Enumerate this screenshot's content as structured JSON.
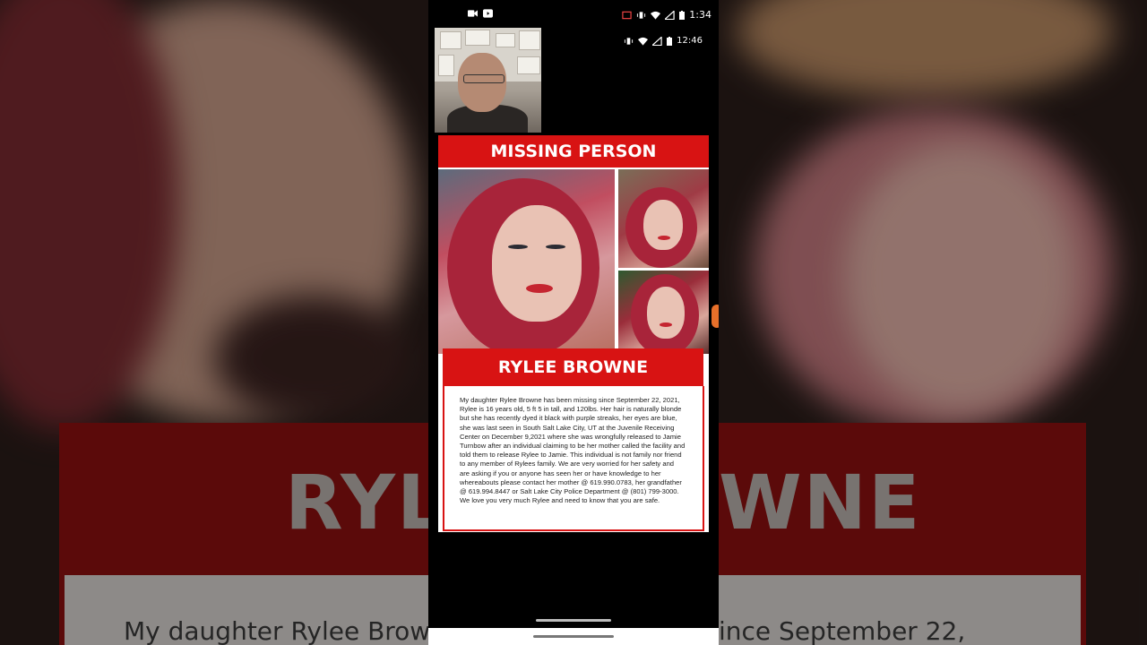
{
  "status_bar": {
    "time": "1:34",
    "left_icons": [
      "video-icon",
      "youtube-icon"
    ],
    "right_icons": [
      "cast-icon",
      "vibrate-icon",
      "wifi-icon",
      "signal-icon",
      "battery-icon"
    ]
  },
  "inner_status": {
    "time": "12:46",
    "icons": [
      "vibrate-icon",
      "wifi-icon",
      "signal-icon",
      "battery-icon"
    ]
  },
  "poster": {
    "header": "MISSING PERSON",
    "name": "RYLEE BROWNE",
    "description": "My daughter Rylee Browne has been missing since September 22, 2021, Rylee is 16 years old, 5 ft 5 in tall, and 120lbs. Her hair is naturally blonde  but she has recently dyed it black with purple streaks, her eyes are blue, she was last seen in South Salt Lake City, UT at the Juvenile Receiving Center on December 9,2021 where she was wrongfully released to Jamie Turnbow after an individual claiming to be her mother called the facility and told them to release Rylee to Jamie. This individual is not family nor friend to any member of Rylees family. We are very worried for her safety and are asking if you or anyone has seen her or have knowledge to her whereabouts please contact her mother @ 619.990.0783, her grandfather @ 619.994.8447 or Salt Lake City Police Department @ (801) 799-3000. We love you very much Rylee and need to know that you are safe."
  },
  "background": {
    "left_big_text": "RYL",
    "right_big_text": "WNE",
    "left_small_text": "My daughter Rylee Brow",
    "right_small_text": "ince September 22,"
  },
  "colors": {
    "poster_red": "#d81313",
    "background": "#000000"
  }
}
